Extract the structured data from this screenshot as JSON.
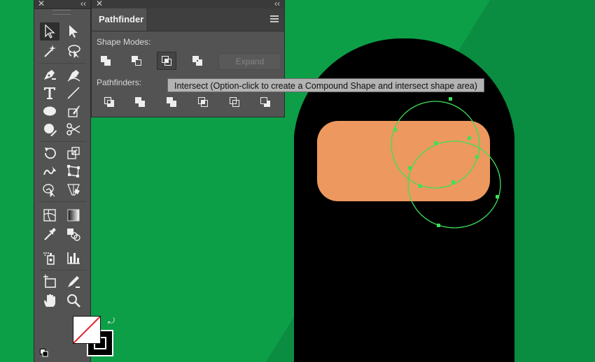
{
  "panel": {
    "title": "Pathfinder",
    "shape_modes_label": "Shape Modes:",
    "pathfinders_label": "Pathfinders:",
    "expand_label": "Expand"
  },
  "tooltip": {
    "text": "Intersect (Option-click to create a Compound Shape and intersect shape area)"
  },
  "tools_panel": {
    "tools": [
      "selection",
      "direct-selection",
      "magic-wand",
      "lasso",
      "pen",
      "curvature",
      "type",
      "line-segment",
      "ellipse",
      "paintbrush",
      "shaper",
      "scissors",
      "rotate",
      "scale",
      "warp",
      "free-transform",
      "shape-builder",
      "perspective-grid",
      "mesh",
      "gradient",
      "eyedropper",
      "blend",
      "symbol-sprayer",
      "column-graph",
      "artboard",
      "slice",
      "hand",
      "zoom"
    ]
  },
  "colors": {
    "background": "#0c9f48",
    "shape_black": "#000000",
    "shape_orange": "#ec985e",
    "selection_green": "#3de05a"
  }
}
